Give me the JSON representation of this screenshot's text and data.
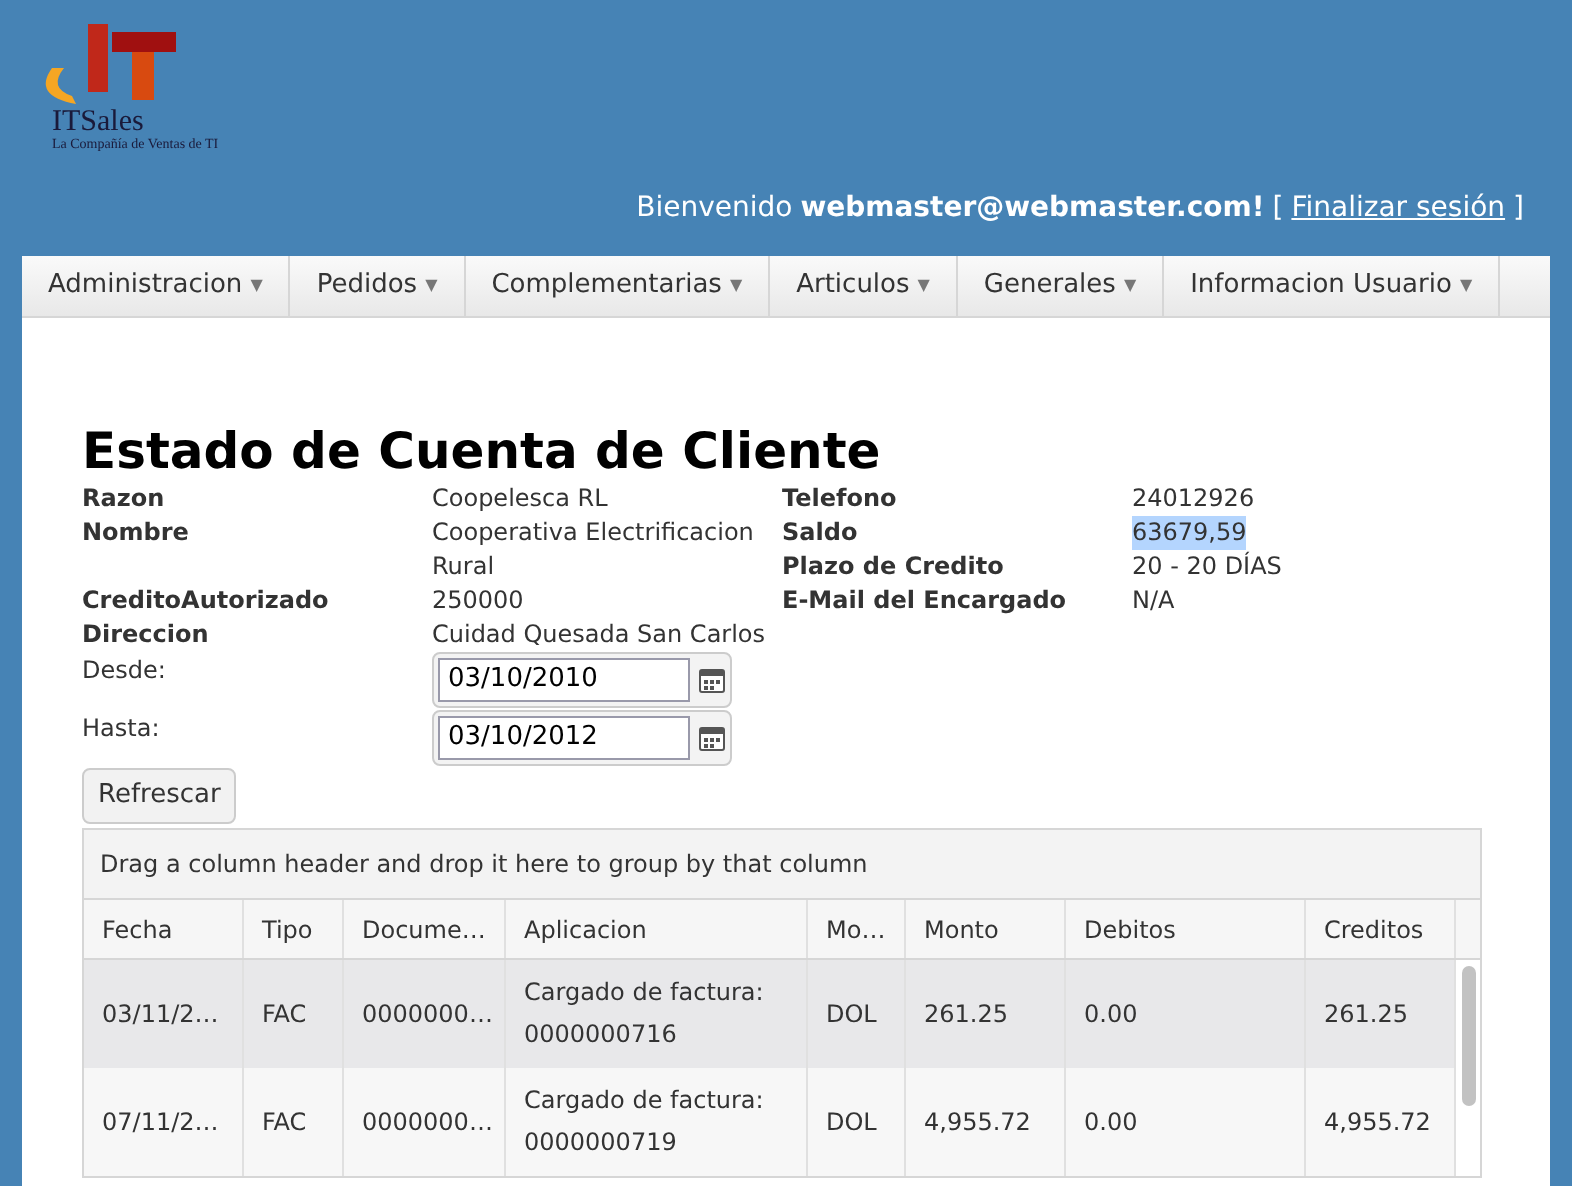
{
  "logo": {
    "name": "ITSales",
    "tagline": "La Compañía de Ventas de TI"
  },
  "header": {
    "welcome": "Bienvenido",
    "user": "webmaster@webmaster.com!",
    "bracket_open": "[",
    "logout": "Finalizar sesión",
    "bracket_close": "]"
  },
  "menu": [
    {
      "label": "Administracion",
      "caret": "▼"
    },
    {
      "label": "Pedidos",
      "caret": "▼"
    },
    {
      "label": "Complementarias",
      "caret": "▼"
    },
    {
      "label": "Articulos",
      "caret": "▼"
    },
    {
      "label": "Generales",
      "caret": "▼"
    },
    {
      "label": "Informacion Usuario",
      "caret": "▼"
    }
  ],
  "title": "Estado de Cuenta de Cliente",
  "details": [
    {
      "label": "Razon",
      "value": "Coopelesca RL",
      "label2": "Telefono",
      "value2": "24012926",
      "highlighted2": false
    },
    {
      "label": "Nombre",
      "value": "Cooperativa Electrificacion Rural",
      "label2": "Saldo",
      "value2": "63679,59",
      "highlighted2": true,
      "label3": "Plazo de Credito",
      "value3": "20 - 20 DÍAS"
    },
    {
      "label": "CreditoAutorizado",
      "value": "250000",
      "label2": "E-Mail del Encargado",
      "value2": "N/A",
      "highlighted2": false
    },
    {
      "label": "Direccion",
      "value": "Cuidad Quesada San Carlos"
    }
  ],
  "dates": [
    {
      "label": "Desde:",
      "value": "03/10/2010"
    },
    {
      "label": "Hasta:",
      "value": "03/10/2012"
    }
  ],
  "refresh_button": "Refrescar",
  "grid": {
    "group_hint": "Drag a column header and drop it here to group by that column",
    "columns": [
      "Fecha",
      "Tipo",
      "Docume…",
      "Aplicacion",
      "Mo…",
      "Monto",
      "Debitos",
      "Creditos"
    ],
    "rows": [
      {
        "selected": true,
        "cells": [
          "03/11/2…",
          "FAC",
          "0000000…",
          "Cargado de factura: 0000000716",
          "DOL",
          "261.25",
          "0.00",
          "261.25"
        ]
      },
      {
        "selected": false,
        "cells": [
          "07/11/2…",
          "FAC",
          "0000000…",
          "Cargado de factura: 0000000719",
          "DOL",
          "4,955.72",
          "0.00",
          "4,955.72"
        ]
      }
    ]
  }
}
